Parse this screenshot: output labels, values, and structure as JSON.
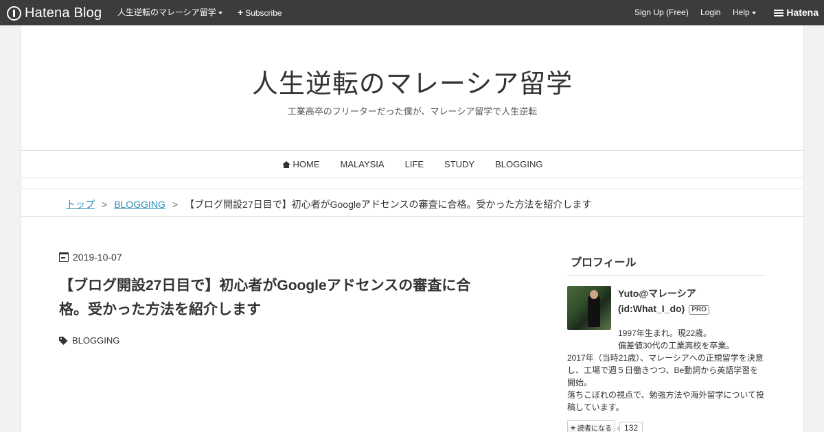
{
  "topbar": {
    "logo_text": "Hatena Blog",
    "blog_menu": "人生逆転のマレーシア留学",
    "subscribe": "Subscribe",
    "signup": "Sign Up (Free)",
    "login": "Login",
    "help": "Help",
    "brand": "Hatena"
  },
  "header": {
    "title": "人生逆転のマレーシア留学",
    "description": "工業高卒のフリーターだった僕が、マレーシア留学で人生逆転"
  },
  "nav": {
    "items": [
      "HOME",
      "MALAYSIA",
      "LIFE",
      "STUDY",
      "BLOGGING"
    ]
  },
  "breadcrumb": {
    "top": "トップ",
    "sep": ">",
    "category": "BLOGGING",
    "current": "【ブログ開設27日目で】初心者がGoogleアドセンスの審査に合格。受かった方法を紹介します"
  },
  "entry": {
    "date": "2019-10-07",
    "title": "【ブログ開設27日目で】初心者がGoogleアドセンスの審査に合格。受かった方法を紹介します",
    "category": "BLOGGING"
  },
  "sidebar": {
    "heading": "プロフィール",
    "name": "Yuto@マレーシア",
    "id": "(id:What_I_do)",
    "pro": "PRO",
    "bio_line1": "1997年生まれ。現22歳。",
    "bio_line2": "偏差値30代の工業高校を卒業。",
    "bio_para1": "2017年（当時21歳）、マレーシアへの正規留学を決意し、工場で週５日働きつつ、Be動詞から英語学習を開始。",
    "bio_para2": "落ちこぼれの視点で、勉強方法や海外留学について投稿しています。",
    "subscribe_label": "読者になる",
    "reader_count": "132"
  },
  "colors": {
    "topbar_bg": "#3c3c3c",
    "link": "#2a8cb5",
    "page_bg": "#f2f2f2"
  }
}
